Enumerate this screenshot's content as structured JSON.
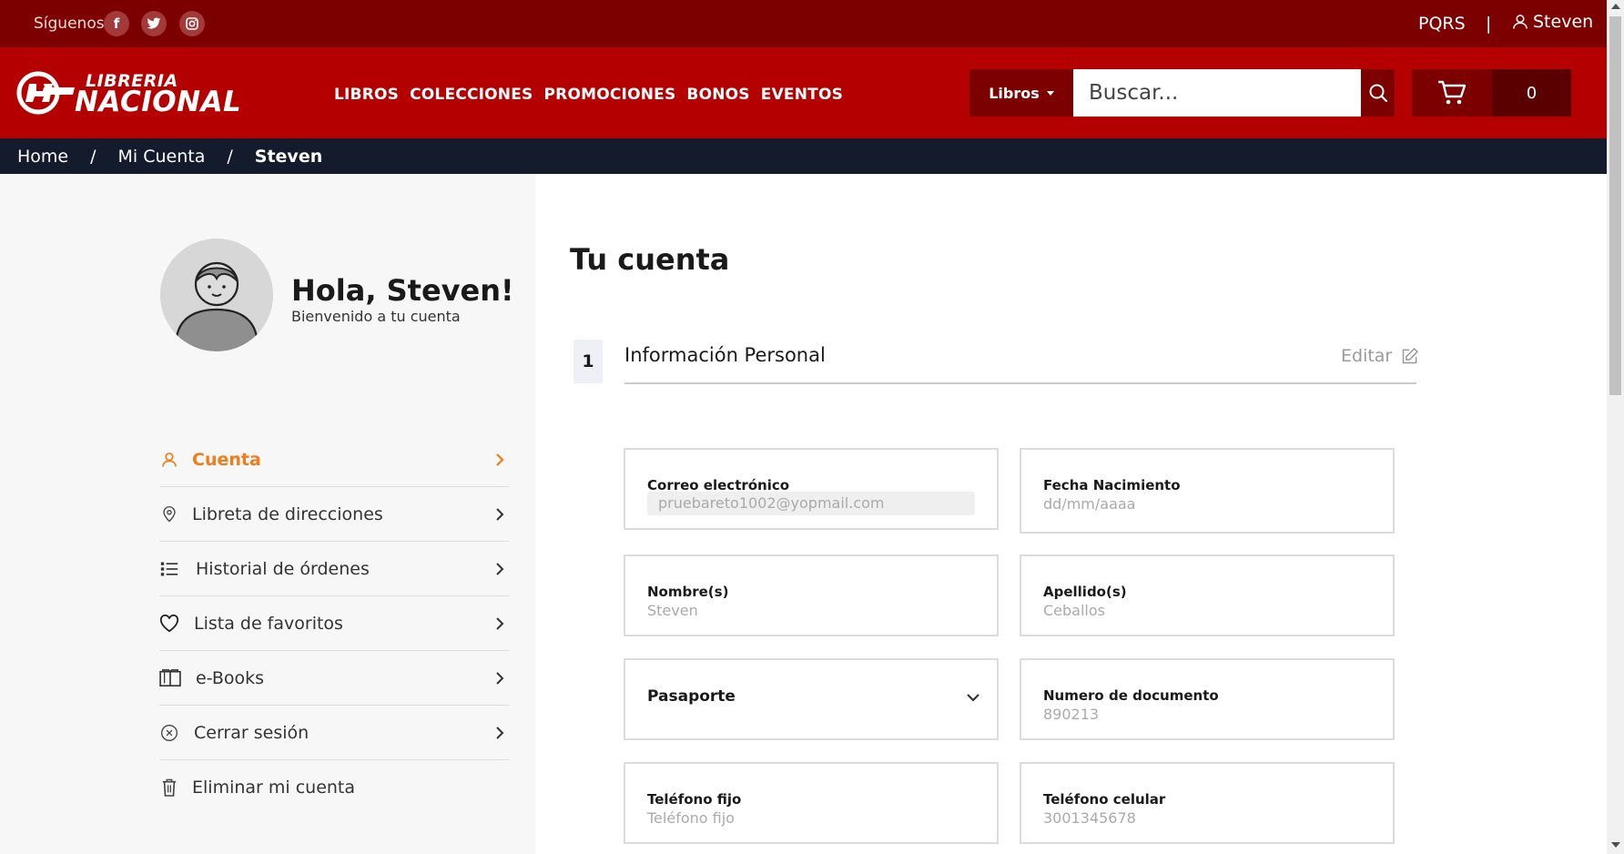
{
  "topbar": {
    "follow_label": "Síguenos",
    "social": [
      {
        "icon": "facebook-icon",
        "glyph": "f"
      },
      {
        "icon": "twitter-icon",
        "glyph": "t"
      },
      {
        "icon": "instagram-icon",
        "glyph": "◎"
      }
    ],
    "pqrs": "PQRS",
    "separator": "|",
    "user_name": "Steven"
  },
  "header": {
    "logo_line1": "LIBRERIA",
    "logo_line2": "NACIONAL",
    "nav": [
      "LIBROS",
      "COLECCIONES",
      "PROMOCIONES",
      "BONOS",
      "EVENTOS"
    ],
    "category_label": "Libros",
    "search_placeholder": "Buscar...",
    "cart_count": "0"
  },
  "breadcrumb": {
    "items": [
      "Home",
      "Mi Cuenta",
      "Steven"
    ],
    "separator": "/"
  },
  "profile": {
    "greeting": "Hola, Steven!",
    "subtitle": "Bienvenido a tu cuenta"
  },
  "menu": [
    {
      "label": "Cuenta",
      "icon": "user-icon",
      "active": true
    },
    {
      "label": "Libreta de direcciones",
      "icon": "location-pin-icon"
    },
    {
      "label": "Historial de órdenes",
      "icon": "list-icon"
    },
    {
      "label": "Lista de favoritos",
      "icon": "heart-icon"
    },
    {
      "label": "e-Books",
      "icon": "book-icon"
    },
    {
      "label": "Cerrar sesión",
      "icon": "close-circle-icon"
    },
    {
      "label": "Eliminar mi cuenta",
      "icon": "trash-icon"
    }
  ],
  "main": {
    "title": "Tu cuenta",
    "section_number": "1",
    "section_title": "Información Personal",
    "edit_label": "Editar"
  },
  "fields": {
    "email": {
      "label": "Correo electrónico",
      "value": "pruebareto1002@yopmail.com"
    },
    "birthdate": {
      "label": "Fecha Nacimiento",
      "value": "dd/mm/aaaa"
    },
    "first_name": {
      "label": "Nombre(s)",
      "value": "Steven"
    },
    "last_name": {
      "label": "Apellido(s)",
      "value": "Ceballos"
    },
    "doc_type": {
      "value": "Pasaporte"
    },
    "doc_number": {
      "label": "Numero de documento",
      "value": "890213"
    },
    "landline": {
      "label": "Teléfono fijo",
      "value": "Teléfono fijo"
    },
    "mobile": {
      "label": "Teléfono celular",
      "value": "3001345678"
    }
  },
  "colors": {
    "topbar": "#7d0000",
    "header": "#b50000",
    "breadcrumb": "#141b2d",
    "active_menu": "#f07d1a"
  }
}
